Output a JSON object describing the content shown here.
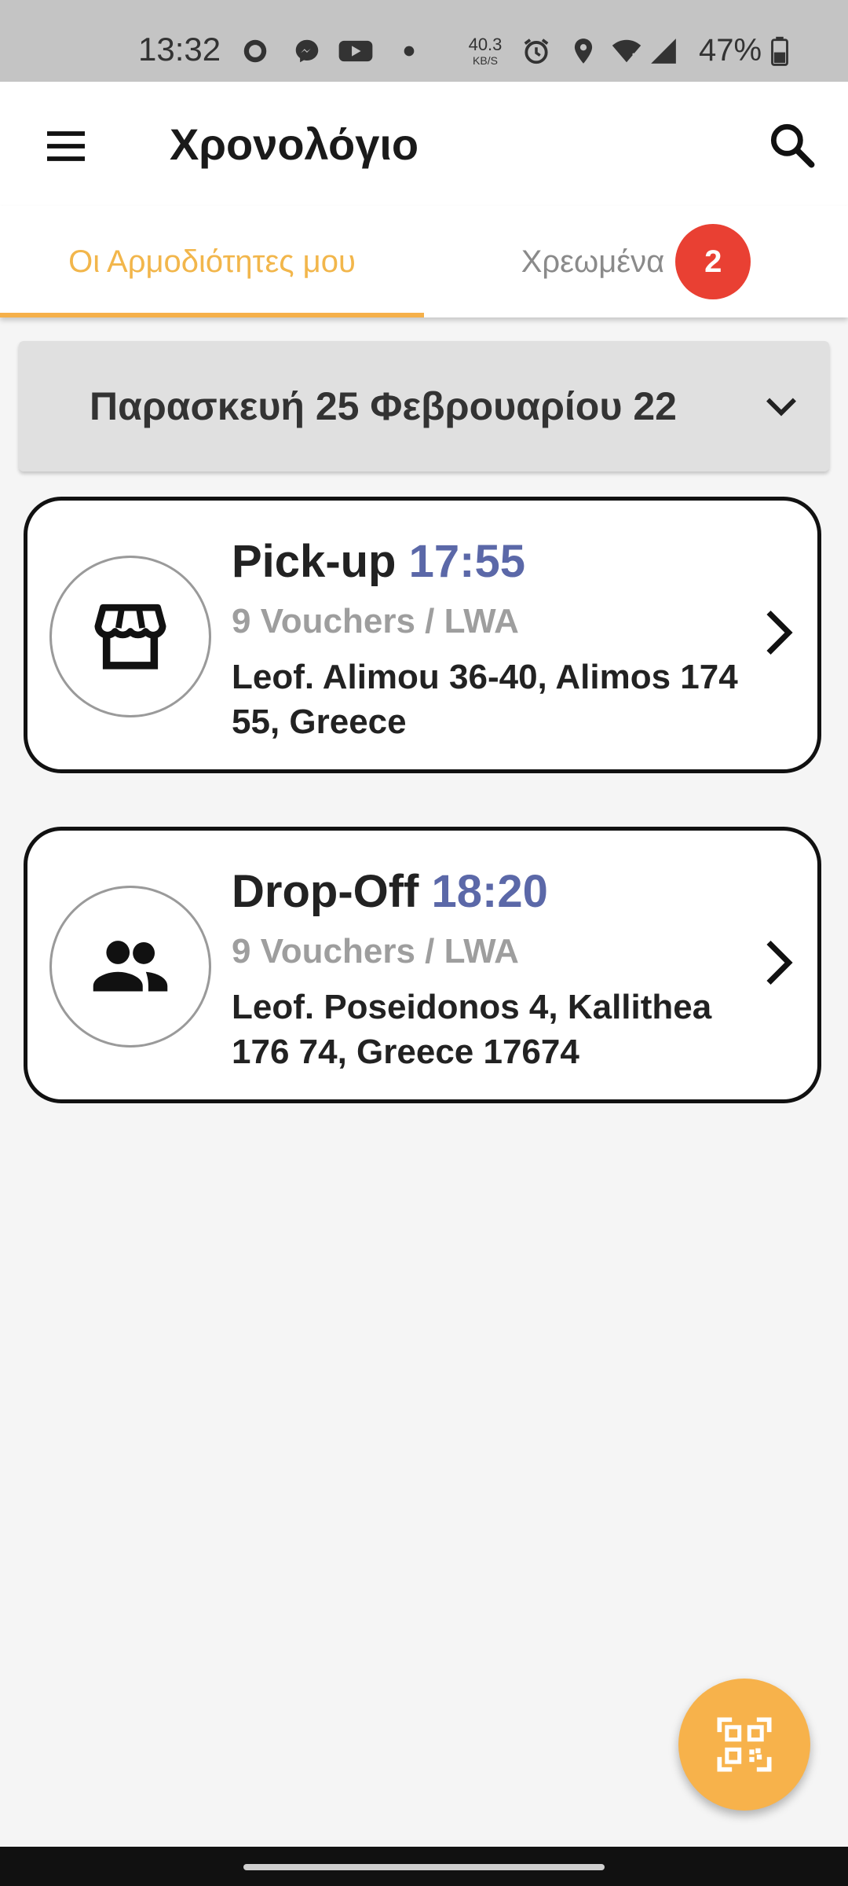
{
  "status_bar": {
    "time": "13:32",
    "net_speed_value": "40.3",
    "net_speed_unit": "KB/S",
    "battery_percent": "47%",
    "icons": [
      "signal-messenger-icon",
      "messenger-icon",
      "youtube-icon",
      "dot-icon",
      "alarm-icon",
      "location-icon",
      "wifi-icon",
      "cell-signal-icon",
      "battery-icon"
    ]
  },
  "app_bar": {
    "title": "Χρονολόγιο",
    "menu_icon": "hamburger-menu-icon",
    "search_icon": "search-icon"
  },
  "tabs": [
    {
      "label": "Οι Αρμοδιότητες μου",
      "active": true
    },
    {
      "label": "Χρεωμένα",
      "active": false,
      "badge": "2"
    }
  ],
  "date_selector": {
    "label": "Παρασκευή 25 Φεβρουαρίου 22",
    "icon": "chevron-down-icon"
  },
  "tasks": [
    {
      "type": "Pick-up",
      "time": "17:55",
      "vouchers": "9 Vouchers / LWA",
      "address": "Leof. Alimou 36-40, Alimos 174 55, Greece",
      "icon": "storefront-icon"
    },
    {
      "type": "Drop-Off",
      "time": "18:20",
      "vouchers": "9 Vouchers / LWA",
      "address": "Leof. Poseidonos 4, Kallithea 176 74, Greece 17674",
      "icon": "people-icon"
    }
  ],
  "fab": {
    "icon": "qr-scan-icon"
  },
  "colors": {
    "accent": "#f7b24b",
    "time_text": "#5b68a8",
    "badge": "#e94033",
    "status_bar": "#c4c4c4"
  }
}
